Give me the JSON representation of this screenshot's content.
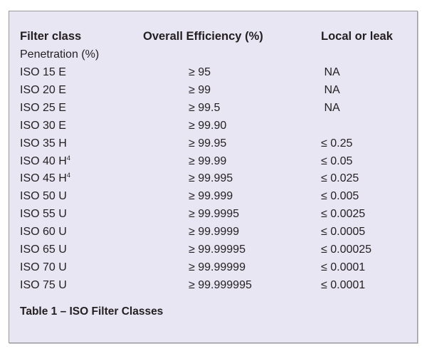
{
  "table": {
    "headers": [
      "Filter class",
      "Overall Efficiency (%)",
      "Local or leak"
    ],
    "subheader": "Penetration (%)",
    "rows": [
      {
        "class": "ISO 15 E",
        "sup": "",
        "efficiency": "≥ 95",
        "leak": " NA"
      },
      {
        "class": "ISO 20 E",
        "sup": "",
        "efficiency": "≥ 99",
        "leak": " NA"
      },
      {
        "class": "ISO 25 E",
        "sup": "",
        "efficiency": "≥ 99.5",
        "leak": " NA"
      },
      {
        "class": "ISO 30 E",
        "sup": "",
        "efficiency": "≥ 99.90",
        "leak": ""
      },
      {
        "class": "ISO 35 H",
        "sup": "",
        "efficiency": "≥ 99.95",
        "leak": "≤ 0.25"
      },
      {
        "class": "ISO 40 H",
        "sup": "4",
        "efficiency": "≥ 99.99",
        "leak": "≤ 0.05"
      },
      {
        "class": "ISO 45 H",
        "sup": "4",
        "efficiency": "≥ 99.995",
        "leak": "≤ 0.025"
      },
      {
        "class": "ISO 50 U",
        "sup": "",
        "efficiency": "≥ 99.999",
        "leak": "≤ 0.005"
      },
      {
        "class": "ISO 55 U",
        "sup": "",
        "efficiency": "≥ 99.9995",
        "leak": "≤ 0.0025"
      },
      {
        "class": "ISO 60 U",
        "sup": "",
        "efficiency": "≥ 99.9999",
        "leak": "≤ 0.0005"
      },
      {
        "class": "ISO 65 U",
        "sup": "",
        "efficiency": "≥ 99.99995",
        "leak": "≤ 0.00025"
      },
      {
        "class": "ISO 70 U",
        "sup": "",
        "efficiency": "≥ 99.99999",
        "leak": "≤ 0.0001"
      },
      {
        "class": "ISO 75 U",
        "sup": "",
        "efficiency": "≥ 99.999995",
        "leak": "≤ 0.0001"
      }
    ],
    "caption": "Table 1 – ISO Filter Classes"
  }
}
